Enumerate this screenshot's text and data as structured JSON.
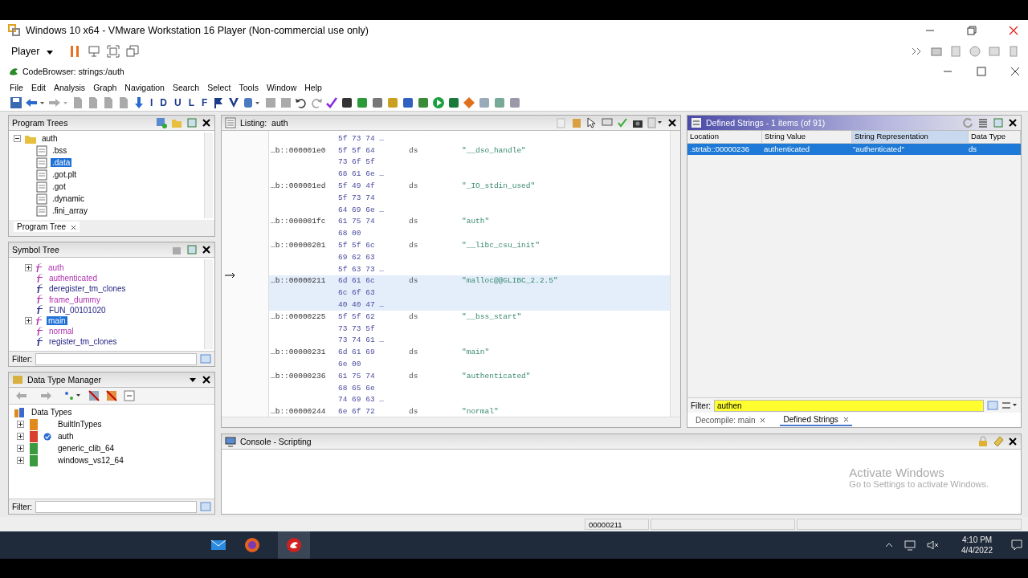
{
  "vm_window": {
    "title": "Windows 10 x64 - VMware Workstation 16 Player (Non-commercial use only)",
    "menu": "Player"
  },
  "app": {
    "title": "CodeBrowser: strings:/auth",
    "menu": [
      "File",
      "Edit",
      "Analysis",
      "Graph",
      "Navigation",
      "Search",
      "Select",
      "Tools",
      "Window",
      "Help"
    ],
    "nav_letters": [
      "I",
      "D",
      "U",
      "L",
      "F"
    ]
  },
  "program_trees": {
    "title": "Program Trees",
    "root": {
      "label": "auth",
      "expanded": true,
      "children": [
        {
          "label": ".bss",
          "selected": false
        },
        {
          "label": ".data",
          "selected": true
        },
        {
          "label": ".got.plt",
          "selected": false
        },
        {
          "label": ".got",
          "selected": false
        },
        {
          "label": ".dynamic",
          "selected": false
        },
        {
          "label": ".fini_array",
          "selected": false
        }
      ]
    },
    "tab": "Program Tree"
  },
  "symbol_tree": {
    "title": "Symbol Tree",
    "items": [
      {
        "label": "auth",
        "expandable": true,
        "selected": false,
        "color": "#b030b0"
      },
      {
        "label": "authenticated",
        "expandable": false,
        "selected": false,
        "color": "#b030b0"
      },
      {
        "label": "deregister_tm_clones",
        "expandable": false,
        "selected": false,
        "color": "#1c1c80"
      },
      {
        "label": "frame_dummy",
        "expandable": false,
        "selected": false,
        "color": "#b030b0"
      },
      {
        "label": "FUN_00101020",
        "expandable": false,
        "selected": false,
        "color": "#1c1c80"
      },
      {
        "label": "main",
        "expandable": true,
        "selected": true,
        "color": "#b030b0"
      },
      {
        "label": "normal",
        "expandable": false,
        "selected": false,
        "color": "#b030b0"
      },
      {
        "label": "register_tm_clones",
        "expandable": false,
        "selected": false,
        "color": "#1c1c80"
      }
    ],
    "filter_label": "Filter:"
  },
  "data_type_manager": {
    "title": "Data Type Manager",
    "root": "Data Types",
    "items": [
      {
        "label": "BuiltInTypes",
        "color": "#e08a1e",
        "in_sync": false
      },
      {
        "label": "auth",
        "color": "#d84030",
        "in_sync": true
      },
      {
        "label": "generic_clib_64",
        "color": "#3a9a40",
        "in_sync": false
      },
      {
        "label": "windows_vs12_64",
        "color": "#3a9a40",
        "in_sync": false
      }
    ],
    "filter_label": "Filter:"
  },
  "listing": {
    "title": "Listing:  auth",
    "entries": [
      {
        "selected": false,
        "bytes": [
          "5f 73 74 …"
        ]
      },
      {
        "address": "…b::000001e0",
        "mnemonic": "ds",
        "operand": "\"__dso_handle\"",
        "selected": false,
        "bytes": [
          "5f 5f 64",
          "73 6f 5f",
          "68 61 6e …"
        ]
      },
      {
        "address": "…b::000001ed",
        "mnemonic": "ds",
        "operand": "\"_IO_stdin_used\"",
        "selected": false,
        "bytes": [
          "5f 49 4f",
          "5f 73 74",
          "64 69 6e …"
        ]
      },
      {
        "address": "…b::000001fc",
        "mnemonic": "ds",
        "operand": "\"auth\"",
        "selected": false,
        "bytes": [
          "61 75 74",
          "68 00"
        ]
      },
      {
        "address": "…b::00000201",
        "mnemonic": "ds",
        "operand": "\"__libc_csu_init\"",
        "selected": false,
        "bytes": [
          "5f 5f 6c",
          "69 62 63",
          "5f 63 73 …"
        ]
      },
      {
        "address": "…b::00000211",
        "mnemonic": "ds",
        "operand": "\"malloc@@GLIBC_2.2.5\"",
        "selected": true,
        "bytes": [
          "6d 61 6c",
          "6c 6f 63",
          "40 40 47 …"
        ]
      },
      {
        "address": "…b::00000225",
        "mnemonic": "ds",
        "operand": "\"__bss_start\"",
        "selected": false,
        "bytes": [
          "5f 5f 62",
          "73 73 5f",
          "73 74 61 …"
        ]
      },
      {
        "address": "…b::00000231",
        "mnemonic": "ds",
        "operand": "\"main\"",
        "selected": false,
        "bytes": [
          "6d 61 69",
          "6e 00"
        ]
      },
      {
        "address": "…b::00000236",
        "mnemonic": "ds",
        "operand": "\"authenticated\"",
        "selected": false,
        "bytes": [
          "61 75 74",
          "68 65 6e",
          "74 69 63 …"
        ]
      },
      {
        "address": "…b::00000244",
        "mnemonic": "ds",
        "operand": "\"normal\"",
        "selected": false,
        "bytes": [
          "6e 6f 72"
        ]
      }
    ]
  },
  "defined_strings": {
    "title": "Defined Strings - 1 items (of 91)",
    "columns": [
      "Location",
      "String Value",
      "String Representation",
      "Data Type"
    ],
    "rows": [
      {
        "selected": true,
        "cells": [
          ".strtab::00000236",
          "authenticated",
          "\"authenticated\"",
          "ds"
        ]
      }
    ],
    "filter": {
      "label": "Filter:",
      "value": "authen"
    },
    "tabs": [
      {
        "label": "Decompile: main",
        "selected": false
      },
      {
        "label": "Defined Strings",
        "selected": true
      }
    ]
  },
  "console": {
    "title": "Console - Scripting"
  },
  "os_notice": {
    "title": "Activate Windows",
    "text": "Go to Settings to activate Windows."
  },
  "status_bar": {
    "address": "00000211"
  },
  "taskbar": {
    "time": "4:10 PM",
    "date": "4/4/2022"
  }
}
